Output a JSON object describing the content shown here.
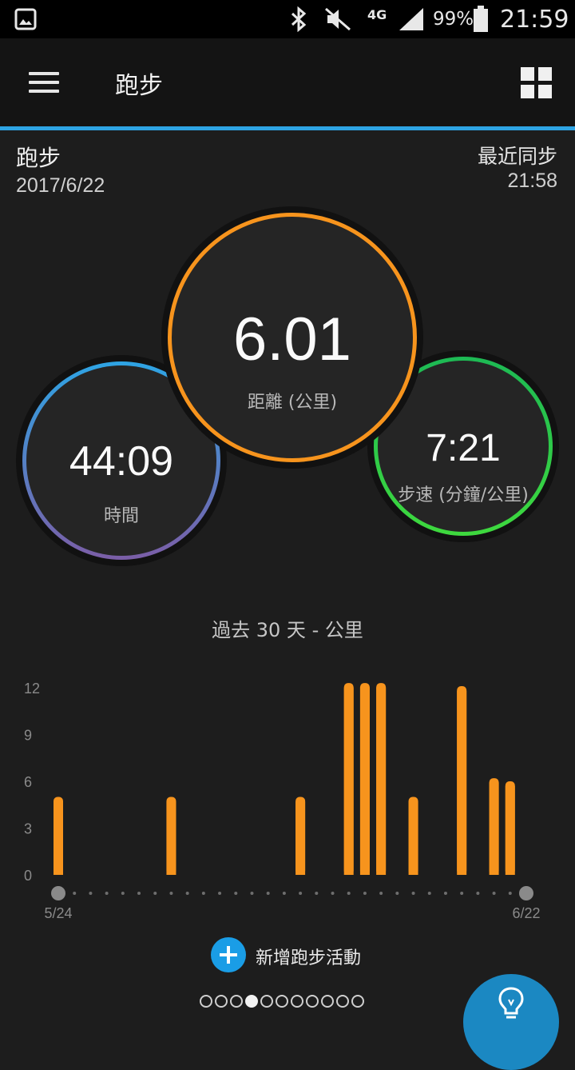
{
  "status_bar": {
    "network": "4G",
    "battery": "99%",
    "time": "21:59",
    "icons": [
      "gallery-icon",
      "bluetooth-icon",
      "mute-icon",
      "signal-icon",
      "battery-icon"
    ]
  },
  "app_bar": {
    "title": "跑步",
    "icons": [
      "menu-icon",
      "grid-view-icon"
    ]
  },
  "activity": {
    "title": "跑步",
    "date": "2017/6/22",
    "sync_label": "最近同步",
    "sync_time": "21:58"
  },
  "stats": {
    "distance": {
      "value": "6.01",
      "label": "距離 (公里)",
      "color": "#f7941d"
    },
    "time": {
      "value": "44:09",
      "label": "時間",
      "color_top": "#2ea4e4",
      "color_bottom": "#7b5ea7"
    },
    "pace": {
      "value": "7:21",
      "label": "步速 (分鐘/公里)",
      "color_top": "#1db954",
      "color_bottom": "#3ed93e"
    }
  },
  "chart_title": "過去 30 天 - 公里",
  "chart_data": {
    "type": "bar",
    "title": "過去 30 天 - 公里",
    "yticks": [
      "12",
      "9",
      "6",
      "3",
      "0"
    ],
    "ylim": [
      0,
      12
    ],
    "x_start_label": "5/24",
    "x_end_label": "6/22",
    "num_days": 30,
    "bar_color": "#f7941d",
    "bars": [
      {
        "day": 1,
        "value": 5.0
      },
      {
        "day": 8,
        "value": 5.0
      },
      {
        "day": 16,
        "value": 5.0
      },
      {
        "day": 19,
        "value": 12.3
      },
      {
        "day": 20,
        "value": 12.3
      },
      {
        "day": 21,
        "value": 12.3
      },
      {
        "day": 23,
        "value": 5.0
      },
      {
        "day": 26,
        "value": 12.1
      },
      {
        "day": 28,
        "value": 6.2
      },
      {
        "day": 29,
        "value": 6.0
      }
    ]
  },
  "add_activity": {
    "label": "新增跑步活動",
    "icon": "plus-icon"
  },
  "pager": {
    "count": 11,
    "active": 4
  },
  "fab": {
    "icon": "lightbulb-icon",
    "color": "#1b88c2"
  }
}
